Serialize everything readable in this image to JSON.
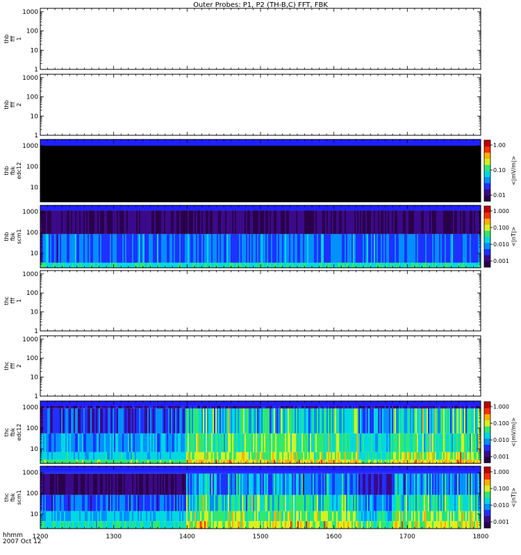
{
  "title": "Outer Probes: P1, P2 (TH-B,C) FFT, FBK",
  "time_axis": {
    "label_line1": "hhmm",
    "label_line2": "2007 Oct 12",
    "ticks": [
      "1200",
      "1300",
      "1400",
      "1500",
      "1600",
      "1700",
      "1800"
    ],
    "range_hhmm": [
      "1200",
      "1800"
    ]
  },
  "colormap": [
    "#2a004a",
    "#3a0a8a",
    "#2030ff",
    "#0090ff",
    "#00d8e0",
    "#30e870",
    "#d8f020",
    "#ffb000",
    "#ff3000",
    "#c00000"
  ],
  "panel_fill_colors": {
    "black": "#000000",
    "blue_band": "#2020ff"
  },
  "chart_data": [
    {
      "type": "heatmap",
      "ylabel": [
        "thb",
        "fff",
        "1"
      ],
      "yscale": "log",
      "ylim": [
        1,
        1500
      ],
      "yticks": [
        "1",
        "10",
        "100",
        "1000"
      ],
      "data": "empty",
      "colorbar": null
    },
    {
      "type": "heatmap",
      "ylabel": [
        "thb",
        "fff",
        "2"
      ],
      "yscale": "log",
      "ylim": [
        1,
        1500
      ],
      "yticks": [
        "1",
        "10",
        "100",
        "1000"
      ],
      "data": "empty",
      "colorbar": null
    },
    {
      "type": "heatmap",
      "ylabel": [
        "thb",
        "fbk",
        "edc12"
      ],
      "yscale": "log",
      "ylim": [
        2,
        2000
      ],
      "yticks": [
        "10",
        "100",
        "1000"
      ],
      "data": "black fill with blue top band",
      "colorbar": {
        "label": "<|mV/m|>",
        "ticks": [
          "0.01",
          "0.10",
          "1.00"
        ]
      }
    },
    {
      "type": "heatmap",
      "ylabel": [
        "thb",
        "fbk",
        "scm1"
      ],
      "yscale": "log",
      "ylim": [
        2,
        2000
      ],
      "yticks": [
        "10",
        "100",
        "1000"
      ],
      "data": "spectrogram, mostly low amplitude",
      "colorbar": {
        "label": "<|nT|>",
        "ticks": [
          "0.001",
          "0.010",
          "0.100",
          "1.000"
        ]
      }
    },
    {
      "type": "heatmap",
      "ylabel": [
        "thc",
        "fff",
        "1"
      ],
      "yscale": "log",
      "ylim": [
        1,
        1500
      ],
      "yticks": [
        "1",
        "10",
        "100",
        "1000"
      ],
      "data": "empty",
      "colorbar": null
    },
    {
      "type": "heatmap",
      "ylabel": [
        "thc",
        "fff",
        "2"
      ],
      "yscale": "log",
      "ylim": [
        1,
        1500
      ],
      "yticks": [
        "1",
        "10",
        "100",
        "1000"
      ],
      "data": "empty",
      "colorbar": null
    },
    {
      "type": "heatmap",
      "ylabel": [
        "thc",
        "fbk",
        "edc12"
      ],
      "yscale": "log",
      "ylim": [
        2,
        2000
      ],
      "yticks": [
        "10",
        "100",
        "1000"
      ],
      "data": "spectrogram, enhanced after ~1400",
      "colorbar": {
        "label": "<|mV/m|>",
        "ticks": [
          "0.001",
          "0.010",
          "0.100",
          "1.000"
        ]
      }
    },
    {
      "type": "heatmap",
      "ylabel": [
        "thc",
        "fbk",
        "scm1"
      ],
      "yscale": "log",
      "ylim": [
        2,
        2000
      ],
      "yticks": [
        "10",
        "100",
        "1000"
      ],
      "data": "spectrogram, enhanced after ~1400",
      "colorbar": {
        "label": "<|nT|>",
        "ticks": [
          "0.001",
          "0.010",
          "0.100",
          "1.000"
        ]
      }
    }
  ]
}
